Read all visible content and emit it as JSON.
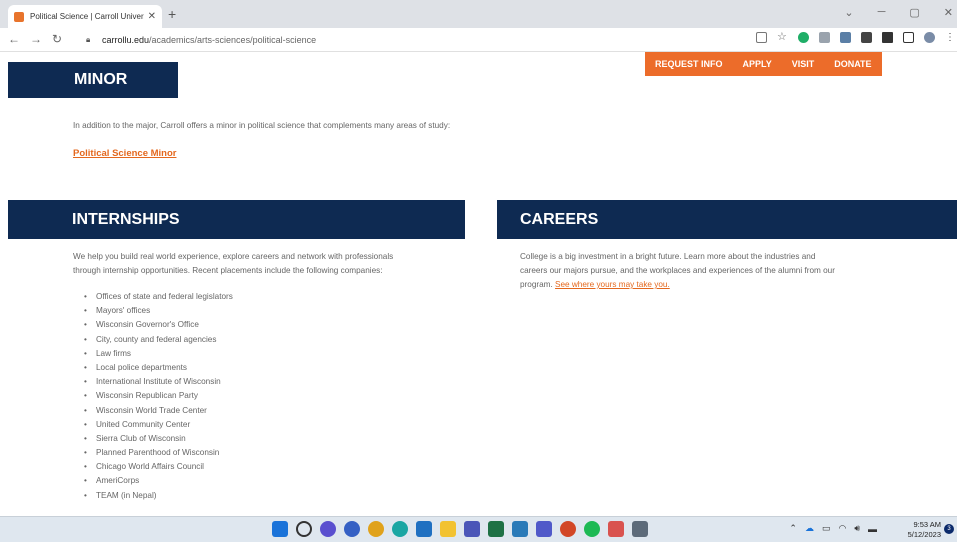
{
  "browser": {
    "tab_title": "Political Science | Carroll Univers",
    "url_domain": "carrollu.edu",
    "url_path": "/academics/arts-sciences/political-science"
  },
  "util_nav": [
    "REQUEST INFO",
    "APPLY",
    "VISIT",
    "DONATE"
  ],
  "minor": {
    "heading": "MINOR",
    "text": "In addition to the major, Carroll offers a minor in political science that complements many areas of study:",
    "link": "Political Science Minor"
  },
  "internships": {
    "heading": "INTERNSHIPS",
    "text_line1": "We help you build real world experience, explore careers and network with professionals",
    "text_line2": "through internship opportunities. Recent placements include the following companies:",
    "items": [
      "Offices of state and federal legislators",
      "Mayors' offices",
      "Wisconsin Governor's Office",
      "City, county and federal agencies",
      "Law firms",
      "Local police departments",
      "International Institute of Wisconsin",
      "Wisconsin Republican Party",
      "Wisconsin World Trade Center",
      "United Community Center",
      "Sierra Club of Wisconsin",
      "Planned Parenthood of Wisconsin",
      "Chicago World Affairs Council",
      "AmeriCorps",
      "TEAM (in Nepal)"
    ]
  },
  "careers": {
    "heading": "CAREERS",
    "text_line1": "College is a big investment in a bright future. Learn more about the industries and",
    "text_line2": "careers our majors pursue, and the workplaces and experiences of the alumni from our",
    "text_line3": "program.",
    "link": "See where yours may take you."
  },
  "taskbar": {
    "time": "9:53 AM",
    "date": "5/12/2023",
    "notification_count": "3"
  },
  "colors": {
    "navy": "#0e2a52",
    "orange": "#ec6c2a"
  }
}
